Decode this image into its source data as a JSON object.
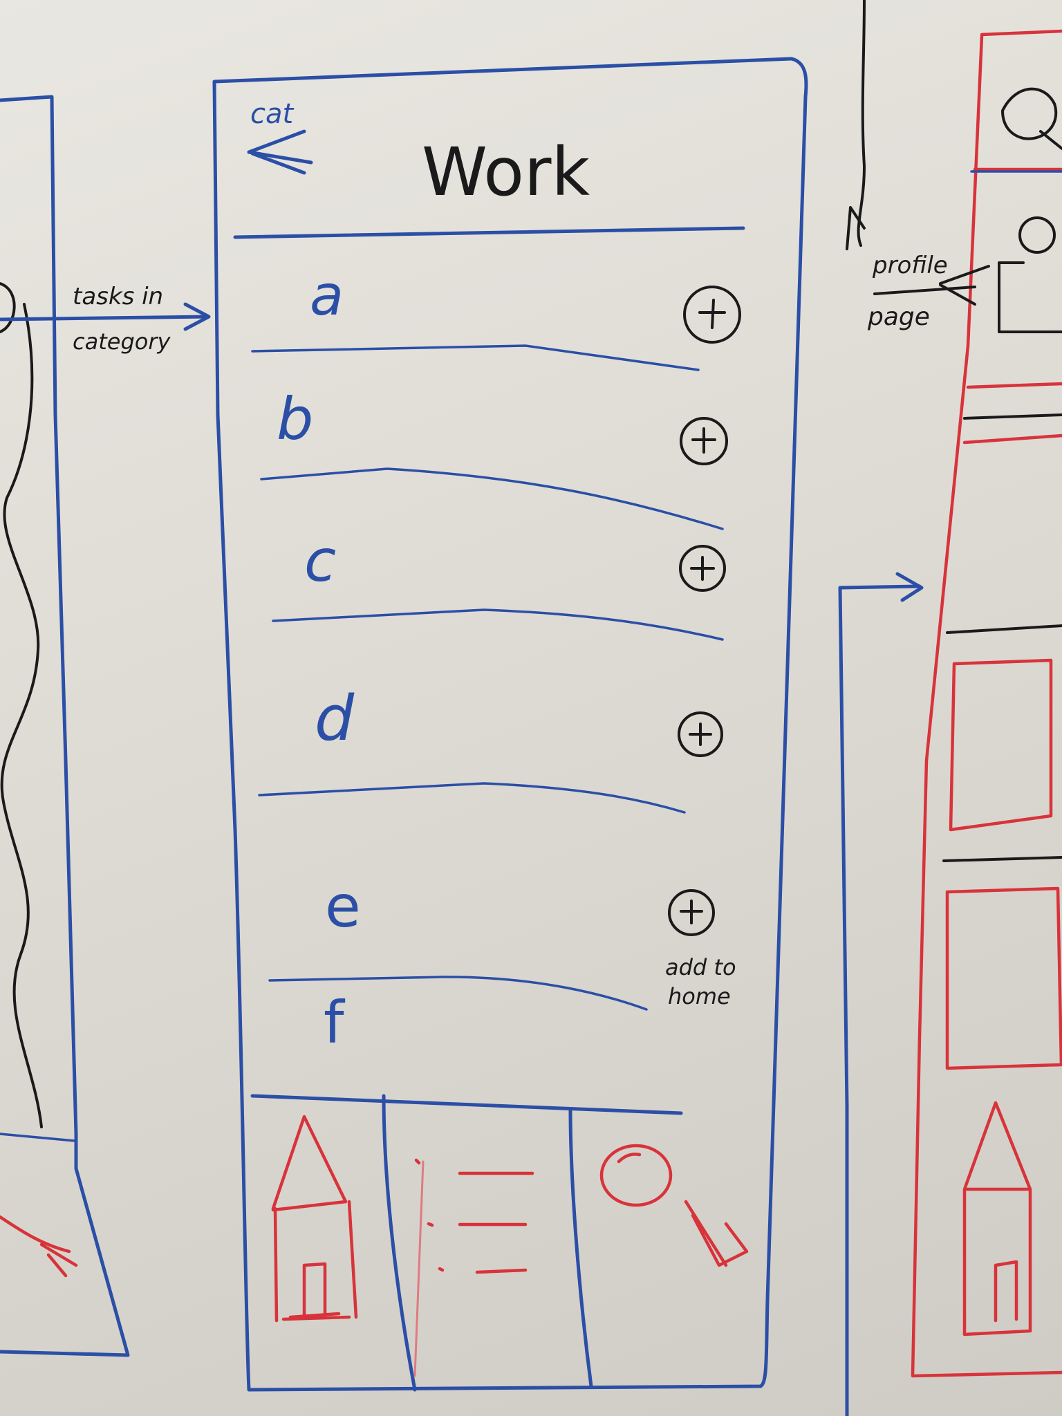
{
  "phone": {
    "back_label": "cat",
    "title": "Work",
    "items": [
      {
        "label": "a"
      },
      {
        "label": "b"
      },
      {
        "label": "c"
      },
      {
        "label": "d"
      },
      {
        "label": "e"
      },
      {
        "label": "f"
      }
    ],
    "add_to_home_note_line1": "add to",
    "add_to_home_note_line2": "home",
    "tab_bar": [
      "home-icon",
      "list-icon",
      "search-icon"
    ]
  },
  "annotations": {
    "arrow_left_line1": "tasks in",
    "arrow_left_line2": "category",
    "arrow_right_line1": "profile",
    "arrow_right_line2": "page"
  },
  "colors": {
    "marker_blue": "#2b4fa6",
    "marker_black": "#1a1a1a",
    "marker_red": "#d8333b",
    "whiteboard": "#e6e3dd"
  }
}
